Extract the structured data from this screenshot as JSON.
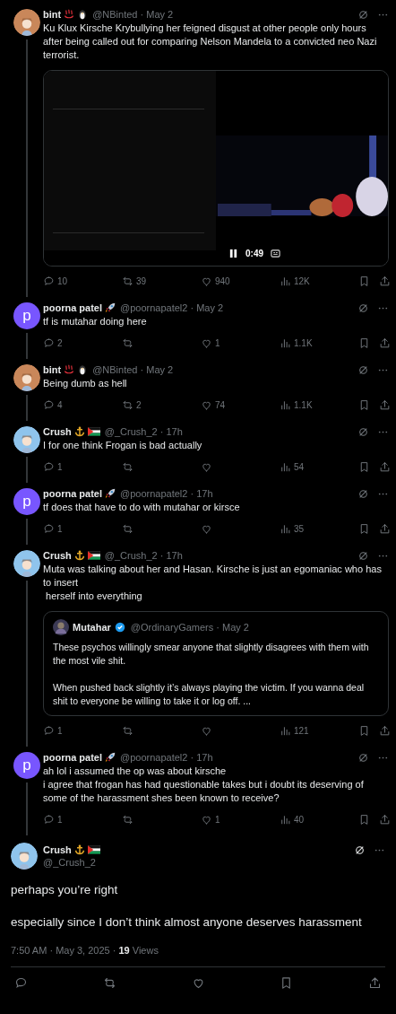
{
  "replies": [
    {
      "author": {
        "name": "bint",
        "badges": [
          {
            "kind": "hot-springs"
          },
          {
            "kind": "penguin"
          }
        ]
      },
      "byline": "@NBinted · May 2",
      "text": "Ku Klux Kirsche Krybullying her feigned disgust at other people only hours after being called out for comparing Nelson Mandela to a convicted neo Nazi terrorist.",
      "video": {
        "kind": "picture",
        "time": "0:49"
      },
      "stats": {
        "replies": "10",
        "reposts": "39",
        "likes": "940",
        "views": "12K"
      }
    },
    {
      "author": {
        "name": "poorna patel",
        "badges": [
          {
            "kind": "rocket"
          }
        ],
        "avatar": {
          "kind": "letter",
          "letter": "p",
          "color": "#7856ff"
        }
      },
      "byline": "@poornapatel2 · May 2",
      "text": "tf is mutahar doing here",
      "stats": {
        "replies": "2",
        "likes": "1",
        "views": "1.1K"
      }
    },
    {
      "author": {
        "name": "bint",
        "badges": [
          {
            "kind": "hot-springs"
          },
          {
            "kind": "penguin"
          }
        ]
      },
      "byline": "@NBinted · May 2",
      "text": "Being dumb as hell",
      "stats": {
        "replies": "4",
        "reposts": "2",
        "likes": "74",
        "views": "1.1K"
      }
    },
    {
      "author": {
        "name": "Crush",
        "badges": [
          {
            "kind": "anchor"
          },
          {
            "kind": "flag"
          }
        ]
      },
      "byline": "@_Crush_2 · 17h",
      "text": "I for one think Frogan is bad actually",
      "stats": {
        "replies": "1",
        "views": "54"
      }
    },
    {
      "author": {
        "name": "poorna patel",
        "badges": [
          {
            "kind": "rocket"
          }
        ],
        "avatar": {
          "kind": "letter",
          "letter": "p",
          "color": "#7856ff"
        }
      },
      "byline": "@poornapatel2 · 17h",
      "text": "tf does that have to do with mutahar or kirsce",
      "stats": {
        "replies": "1",
        "views": "35"
      }
    },
    {
      "author": {
        "name": "Crush",
        "badges": [
          {
            "kind": "anchor"
          },
          {
            "kind": "flag"
          }
        ]
      },
      "byline": "@_Crush_2 · 17h",
      "text": "Muta was talking about her and Hasan. Kirsche is just an egomaniac who has to insert\n herself into everything",
      "quote": {
        "name": "Mutahar",
        "verified": true,
        "byline": "@OrdinaryGamers · May 2",
        "text": "These psychos willingly smear anyone that slightly disagrees with them with the most vile shit.\n\nWhen pushed back slightly it’s always playing the victim. If you wanna deal shit to everyone be willing to take it or log off. ..."
      },
      "stats": {
        "replies": "1",
        "views": "121"
      }
    },
    {
      "author": {
        "name": "poorna patel",
        "badges": [
          {
            "kind": "rocket"
          }
        ],
        "avatar": {
          "kind": "letter",
          "letter": "p",
          "color": "#7856ff"
        }
      },
      "byline": "@poornapatel2 · 17h",
      "text": "ah lol i assumed the op was about kirsche\ni agree that frogan has had questionable takes but i doubt its deserving of some of the harassment shes been known to receive?",
      "stats": {
        "replies": "1",
        "likes": "1",
        "views": "40"
      }
    }
  ],
  "main": {
    "author": {
      "name": "Crush",
      "badges": [
        {
          "kind": "anchor"
        },
        {
          "kind": "flag"
        }
      ]
    },
    "handle": "@_Crush_2",
    "text": "perhaps you’re right\n\nespecially since I don’t think almost anyone deserves harassment",
    "meta": "7:50 AM · May 3, 2025 · **19** Views"
  }
}
